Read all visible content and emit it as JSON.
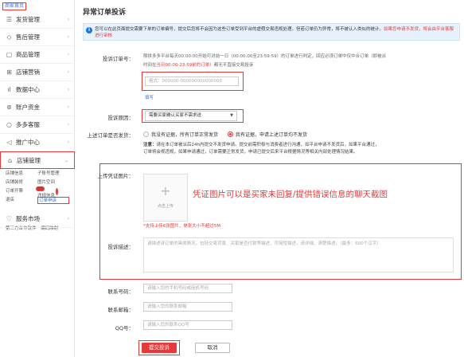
{
  "sidebar": {
    "home": "商家首页",
    "items": [
      {
        "label": "发货管理",
        "icon": "list-icon"
      },
      {
        "label": "售后管理",
        "icon": "shield-icon"
      },
      {
        "label": "商品管理",
        "icon": "box-icon"
      },
      {
        "label": "店铺营销",
        "icon": "store-icon"
      },
      {
        "label": "数据中心",
        "icon": "chart-icon"
      },
      {
        "label": "账户资金",
        "icon": "wallet-icon"
      },
      {
        "label": "多多客服",
        "icon": "chat-icon"
      },
      {
        "label": "推广中心",
        "icon": "megaphone-icon"
      },
      {
        "label": "店铺管理",
        "icon": "shop-icon"
      }
    ],
    "shop_sub": [
      "店铺信息",
      "子账号管理",
      "店铺装修",
      "图片空间",
      "订单开票",
      "违规信息",
      "退店",
      "订单申诉"
    ],
    "shop_sub_badge": "63",
    "service": {
      "label": "服务市场",
      "icon": "heart-icon",
      "sub": [
        "第三方合作软件",
        "编码映射"
      ]
    }
  },
  "main": {
    "title": "异常订单投诉",
    "notice": {
      "pre": "您可以在此页面提交需要下单的订单编号，提交后您将不会因为这些订单受到平台的虚假交易违规处理。但若订单仍为异常，将不被认入类似的统计。",
      "highlight": "如果您申请不发货，将会由平台客服进行审核"
    },
    "order_label": "投诉订单号：",
    "order_desc_1": "限拼多多平台每天00:00:00开始可对前一日（00:00:00至23:59:59）的订单进行判定，回应必须订单中仅中合订单（即被派",
    "order_desc_2_pre": "时间在",
    "order_desc_2_red": "当日00:00-23:59前的订单",
    "order_desc_2_post": "）都无平直接交易投诉",
    "order_placeholder": "格式：000000-000000000000000",
    "fill_link": "填写",
    "reason_label": "投诉原因：",
    "reason_value": "需要买家确认买家不需求送",
    "evidence_label": "上述订单是否发货：",
    "radio_1": "我没有证据，所有订单正常发货",
    "radio_2": "我有证据，申请上述订单均不发货",
    "note_title": "注意：",
    "note_1": "请在本订单被派后24h内提交不发货申请。提交前需积极与消费者进行沟通，如平台申请不发货后，如果平台通过，",
    "note_2": "订单将会视违规，如果申请通过，订单需要正常发货，申请已提交后来平台根据情况等相关内部处理情况结果。",
    "upload_label": "上传凭证图片：",
    "upload_text": "点击上传",
    "annotation": "凭证图片可以是买家未回复/提供错误信息的聊天截图",
    "upload_hint": "*支持上传6张图片，单张大小不超过5M",
    "desc_label": "投诉描述：",
    "desc_placeholder": "请描述该订单的具体情况，包括交易背景、买家是否付款等描述，可简短描述，请详细、清楚描述。（最多：600个汉字）",
    "phone_label": "联系号码：",
    "phone_placeholder": "请输入您的手机号码或座机号码",
    "email_label": "联系邮箱：",
    "email_placeholder": "请输入您的联系邮箱",
    "qq_label": "QQ号：",
    "qq_placeholder": "请输入您的联系QQ号",
    "submit": "提交投诉",
    "cancel": "取消"
  }
}
